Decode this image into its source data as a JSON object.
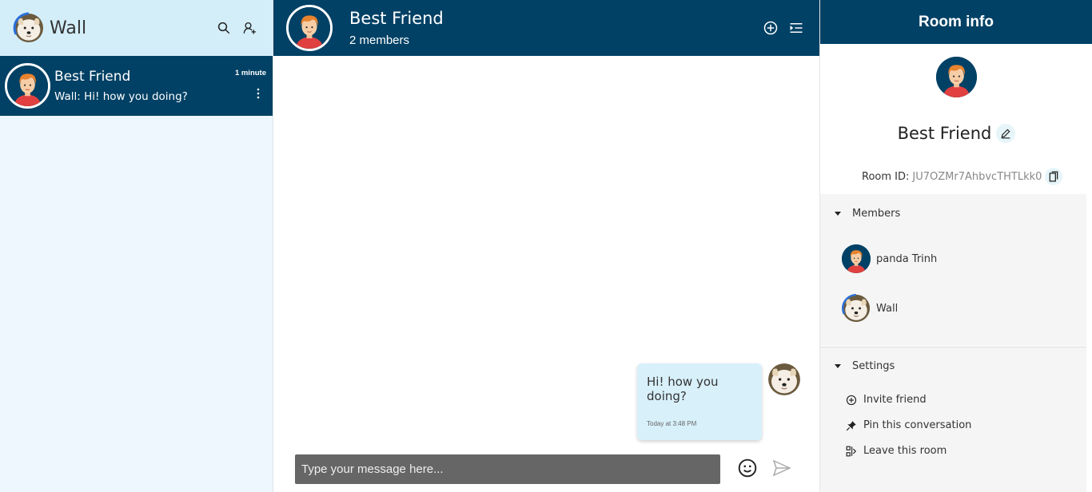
{
  "sidebar": {
    "user_name": "Wall",
    "rooms": [
      {
        "name": "Best Friend",
        "last_message": "Wall: Hi! how you doing?",
        "time": "1 minute"
      }
    ]
  },
  "chat": {
    "title": "Best Friend",
    "members_count": "2 members",
    "messages": [
      {
        "text": "Hi! how you doing?",
        "time": "Today at 3:48 PM"
      }
    ],
    "composer_placeholder": "Type your message here..."
  },
  "info": {
    "header": "Room info",
    "room_name": "Best Friend",
    "room_id_label": "Room ID:",
    "room_id": "JU7OZMr7AhbvcTHTLkk0",
    "members_label": "Members",
    "members": [
      "panda Trinh",
      "Wall"
    ],
    "settings_label": "Settings",
    "settings": [
      "Invite friend",
      "Pin this conversation",
      "Leave this room"
    ]
  },
  "colors": {
    "brand": "#004165",
    "sidebar_bg": "#eef7fd",
    "bubble": "#d8f0fa"
  }
}
